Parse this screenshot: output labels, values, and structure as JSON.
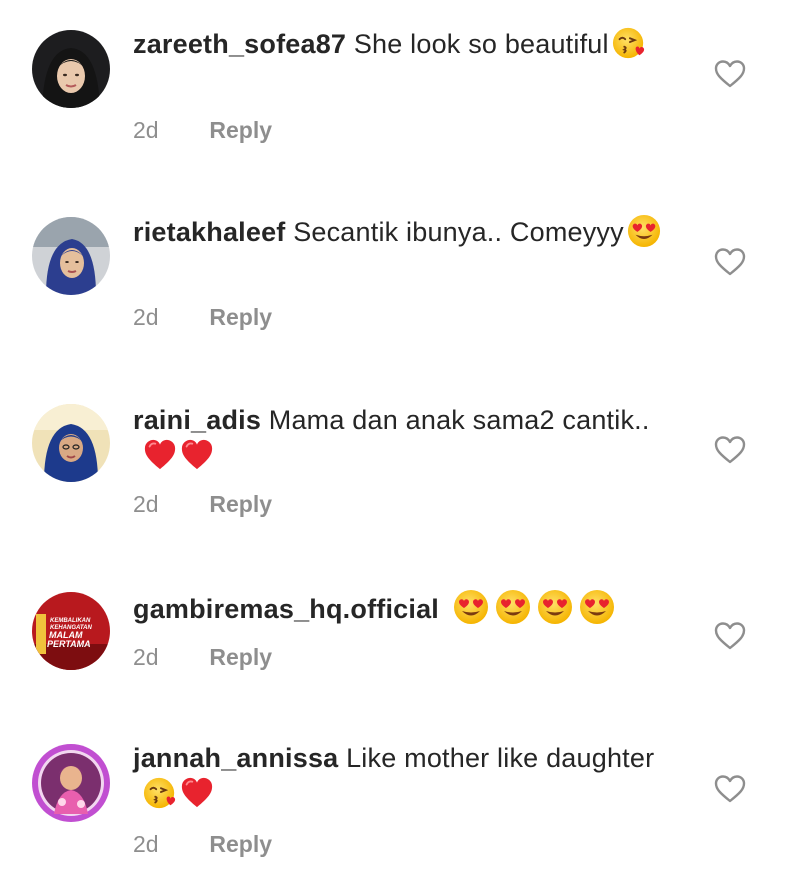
{
  "comments": [
    {
      "username": "zareeth_sofea87",
      "text": "She look so beautiful",
      "emojis": [
        "kiss-emoji"
      ],
      "time": "2d",
      "reply_label": "Reply"
    },
    {
      "username": "rietakhaleef",
      "text": "Secantik ibunya.. Comeyyy",
      "emojis": [
        "heart-eyes-emoji"
      ],
      "time": "2d",
      "reply_label": "Reply"
    },
    {
      "username": "raini_adis",
      "text": "Mama dan anak sama2 cantik..",
      "emojis": [
        "red-heart-emoji",
        "red-heart-emoji"
      ],
      "time": "2d",
      "reply_label": "Reply"
    },
    {
      "username": "gambiremas_hq.official",
      "text": "",
      "emojis": [
        "heart-eyes-emoji",
        "heart-eyes-emoji",
        "heart-eyes-emoji",
        "heart-eyes-emoji"
      ],
      "time": "2d",
      "reply_label": "Reply"
    },
    {
      "username": "jannah_annissa",
      "text": "Like mother like daughter",
      "emojis": [
        "kiss-emoji",
        "red-heart-emoji"
      ],
      "time": "2d",
      "reply_label": "Reply"
    }
  ],
  "avatar_logo_text": "KEMBALIKAN KEHANGATAN MALAM PERTAMA",
  "colors": {
    "text": "#262626",
    "secondary": "#8e8e8e",
    "heart_outline": "#8e8e8e",
    "emoji_face": "#ffcc33",
    "emoji_heart": "#e8232e"
  },
  "icons": {
    "like": "heart-outline-icon"
  }
}
